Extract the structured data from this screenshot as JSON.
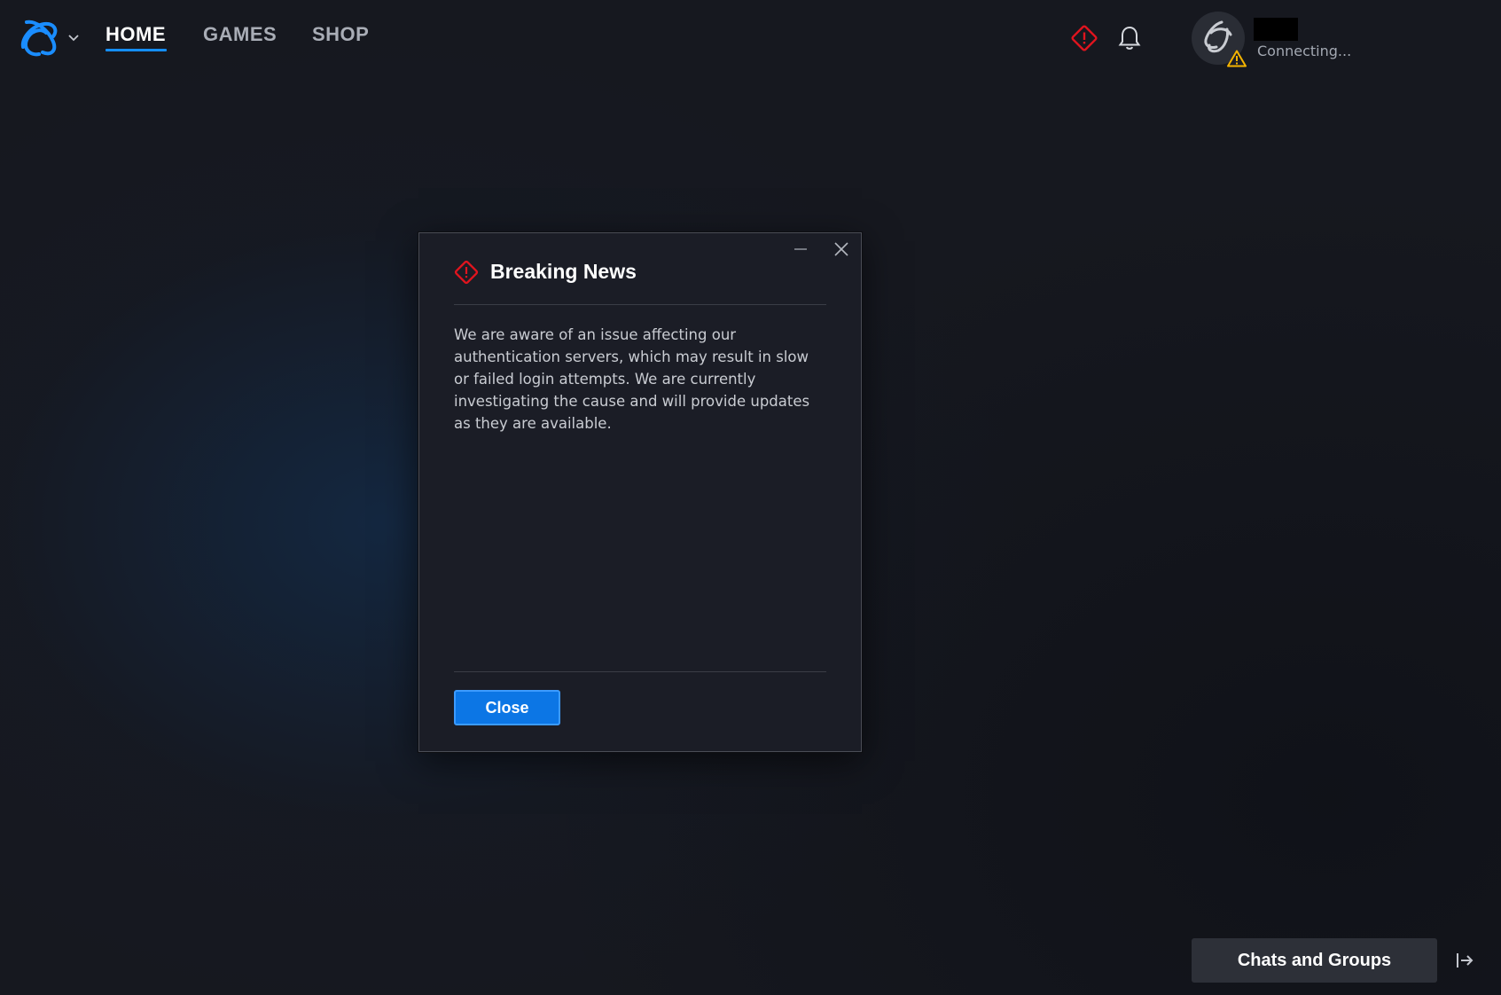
{
  "nav": {
    "tabs": [
      {
        "label": "HOME",
        "active": true
      },
      {
        "label": "GAMES",
        "active": false
      },
      {
        "label": "SHOP",
        "active": false
      }
    ]
  },
  "header": {
    "alert_icon": "alert-diamond-icon",
    "notifications_icon": "bell-icon",
    "status": "Connecting..."
  },
  "dialog": {
    "title": "Breaking News",
    "body": "We are aware of an issue affecting our authentication servers, which may result in slow or failed login attempts. We are currently investigating the cause and will provide updates as they are available.",
    "button_label": "Close"
  },
  "footer": {
    "chats_label": "Chats and Groups"
  },
  "colors": {
    "accent": "#148eff",
    "alert": "#e0141e",
    "warning": "#f5b400",
    "button": "#0c76e5"
  }
}
